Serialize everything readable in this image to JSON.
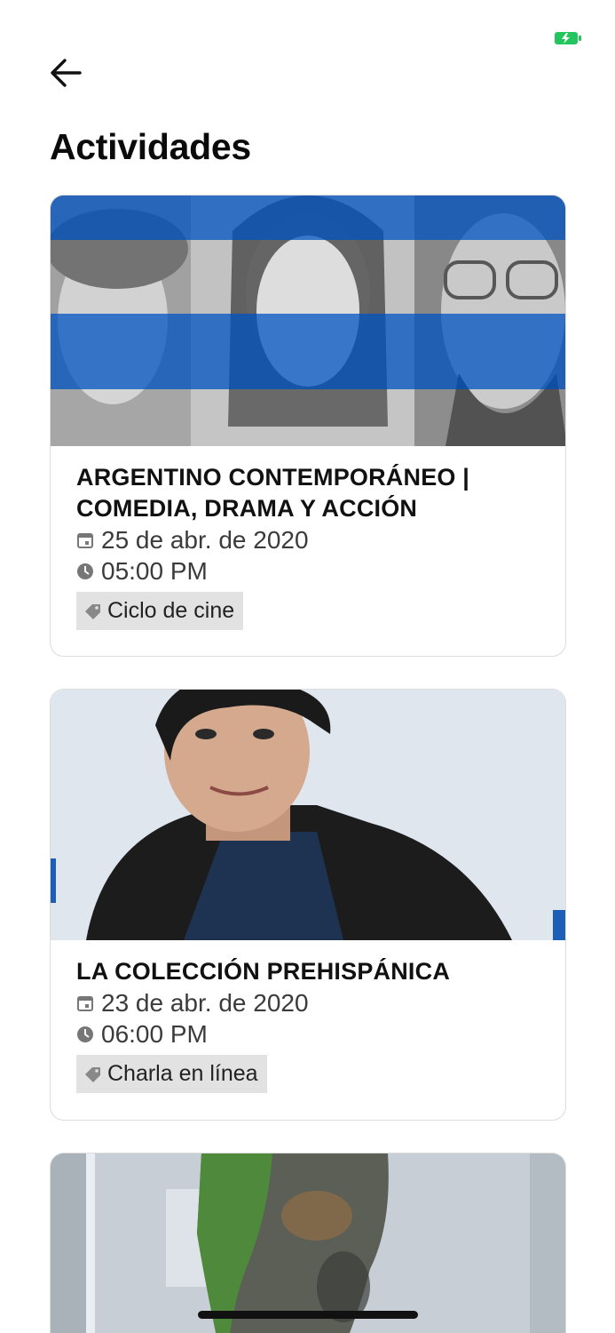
{
  "header": {
    "title": "Actividades"
  },
  "colors": {
    "battery": "#22c55e",
    "tag_bg": "#e2e2e2",
    "card_border": "#dcdcdc"
  },
  "icons": {
    "back": "arrow-left-icon",
    "date": "calendar-icon",
    "time": "clock-icon",
    "tag": "tag-icon"
  },
  "activities": [
    {
      "title": "ARGENTINO CONTEMPORÁNEO | COMEDIA, DRAMA Y ACCIÓN",
      "date": "25 de abr. de 2020",
      "time": "05:00 PM",
      "category": "Ciclo de cine"
    },
    {
      "title": "LA COLECCIÓN PREHISPÁNICA",
      "date": "23 de abr. de 2020",
      "time": "06:00 PM",
      "category": "Charla en línea"
    },
    {
      "title": "",
      "date": "",
      "time": "",
      "category": ""
    }
  ]
}
